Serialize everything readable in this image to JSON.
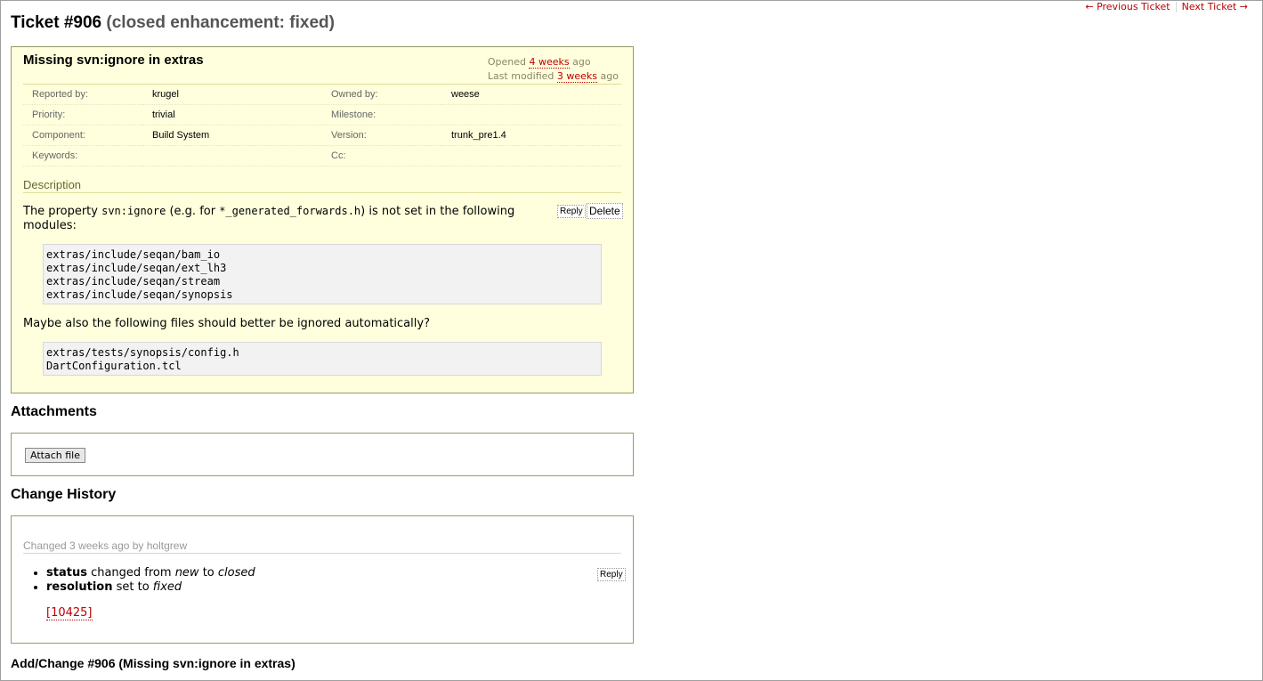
{
  "nav": {
    "prev_label": "← Previous Ticket",
    "next_label": "Next Ticket →"
  },
  "ticket": {
    "title": "Ticket #906",
    "status": "(closed enhancement: fixed)",
    "summary": "Missing svn:ignore in extras",
    "opened_prefix": "Opened",
    "opened_link": "4 weeks",
    "opened_suffix": "ago",
    "modified_prefix": "Last modified",
    "modified_link": "3 weeks",
    "modified_suffix": "ago",
    "properties": [
      {
        "label1": "Reported by:",
        "value1": "krugel",
        "label2": "Owned by:",
        "value2": "weese"
      },
      {
        "label1": "Priority:",
        "value1": "trivial",
        "label2": "Milestone:",
        "value2": ""
      },
      {
        "label1": "Component:",
        "value1": "Build System",
        "label2": "Version:",
        "value2": "trunk_pre1.4"
      },
      {
        "label1": "Keywords:",
        "value1": "",
        "label2": "Cc:",
        "value2": ""
      }
    ],
    "description_heading": "Description",
    "desc_part1": "The property ",
    "desc_code1": "svn:ignore",
    "desc_part2": " (e.g. for ",
    "desc_code2": "*_generated_forwards.h",
    "desc_part3": ") is not set in the following modules:",
    "modules_block": "extras/include/seqan/bam_io\nextras/include/seqan/ext_lh3\nextras/include/seqan/stream\nextras/include/seqan/synopsis",
    "maybe_text": "Maybe also the following files should better be ignored automatically?",
    "files_block": "extras/tests/synopsis/config.h\nDartConfiguration.tcl",
    "reply_label": "Reply",
    "delete_label": "Delete"
  },
  "attachments": {
    "heading": "Attachments",
    "attach_label": "Attach file"
  },
  "history": {
    "heading": "Change History",
    "change_header": "Changed 3 weeks ago by holtgrew",
    "reply_label": "Reply",
    "changes": [
      {
        "field": "status",
        "text1": " changed from ",
        "from": "new",
        "text2": " to ",
        "to": "closed"
      },
      {
        "field": "resolution",
        "text1": " set to ",
        "to": "fixed"
      }
    ],
    "changeset": "[10425]"
  },
  "add_change": {
    "heading": "Add/Change #906 (Missing svn:ignore in extras)"
  }
}
